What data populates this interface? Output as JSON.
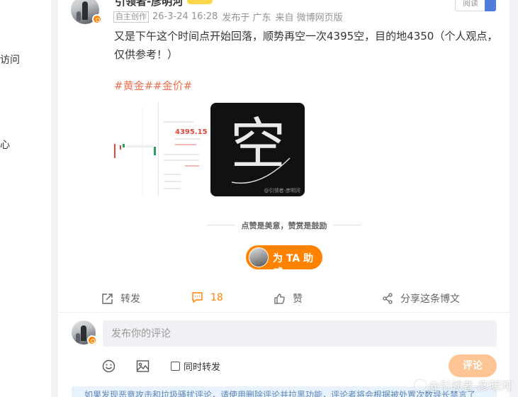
{
  "left_panel": {
    "fragment_1": "访问",
    "fragment_2": "心"
  },
  "post": {
    "author": "引领者-彦明河",
    "source_tag": "自主创作",
    "timestamp": "26-3-24 16:28",
    "location": "发布于 广东",
    "via": "来自 微博网页版",
    "follow_label": "阅读",
    "text": "又是下午这个时间点开始回落，顺势再空一次4395空，目的地4350（个人观点，仅供参考！）",
    "topics": "#黄金##金价#",
    "image_1": {
      "alt": "gold price chart screenshot",
      "price": "4395.15"
    },
    "image_2": {
      "glyph": "空",
      "watermark": "@引领者-彦明河"
    }
  },
  "reward": {
    "caption": "点赞是美意，赞赏是鼓励",
    "boost_label": "为 TA 助威"
  },
  "actions": {
    "repost": "转发",
    "comment_count": "18",
    "like": "赞",
    "share": "分享这条博文"
  },
  "comment_box": {
    "placeholder": "发布你的评论",
    "also_repost": "同时转发",
    "submit": "评论"
  },
  "notice": "如果发现恶意攻击和垃圾骚扰评论，请使用删除评论并拉黑功能，评论者将会根据被处置次数导长禁言了",
  "overlay_watermark": "@引领者-彦明河",
  "colors": {
    "accent": "#ff8200",
    "topic": "#eb7350",
    "submit_disabled": "#ffc494",
    "notice_bg": "#e8f2fc"
  }
}
